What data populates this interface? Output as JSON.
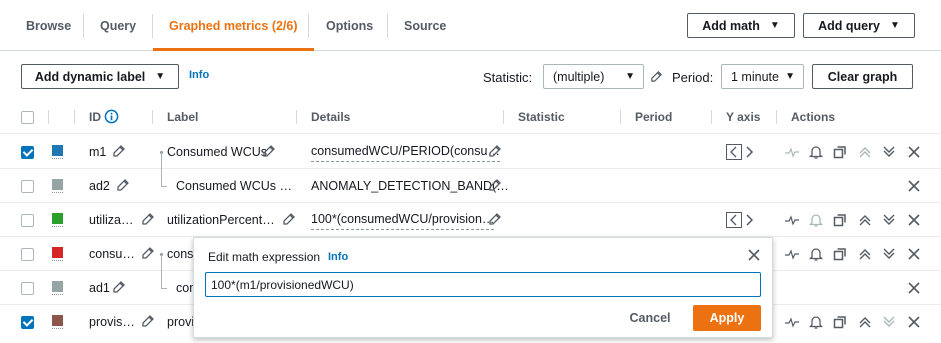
{
  "tabs": [
    {
      "label": "Browse"
    },
    {
      "label": "Query"
    },
    {
      "label": "Graphed metrics (2/6)"
    },
    {
      "label": "Options"
    },
    {
      "label": "Source"
    }
  ],
  "header_buttons": {
    "add_math": "Add math",
    "add_query": "Add query"
  },
  "toolbar": {
    "add_dynamic_label": "Add dynamic label",
    "info": "Info",
    "statistic_label": "Statistic:",
    "statistic_value": "(multiple)",
    "period_label": "Period:",
    "period_value": "1 minute",
    "clear_graph": "Clear graph"
  },
  "columns": {
    "id": "ID",
    "label": "Label",
    "details": "Details",
    "statistic": "Statistic",
    "period": "Period",
    "yaxis": "Y axis",
    "actions": "Actions"
  },
  "rows": [
    {
      "checked": true,
      "color": "#1f77b4",
      "id": "m1",
      "label": "Consumed WCUs",
      "details": "consumedWCU/PERIOD(consu…"
    },
    {
      "checked": false,
      "color": "#95a5a6",
      "id": "ad2",
      "label": "Consumed WCUs …",
      "details": "ANOMALY_DETECTION_BAND(…"
    },
    {
      "checked": false,
      "color": "#2ca02c",
      "id": "utiliza…",
      "label": "utilizationPercent…",
      "details": "100*(consumedWCU/provision…"
    },
    {
      "checked": false,
      "color": "#d62728",
      "id": "consu…",
      "label": "consu",
      "details": ""
    },
    {
      "checked": false,
      "color": "#95a5a6",
      "id": "ad1",
      "label": "con",
      "details": ""
    },
    {
      "checked": true,
      "color": "#8c564b",
      "id": "provis…",
      "label": "provi",
      "details": ""
    }
  ],
  "popover": {
    "title": "Edit math expression",
    "info": "Info",
    "expression": "100*(m1/provisionedWCU)",
    "cancel": "Cancel",
    "apply": "Apply"
  },
  "colors": {
    "accent": "#ec7211",
    "link": "#0073bb"
  }
}
